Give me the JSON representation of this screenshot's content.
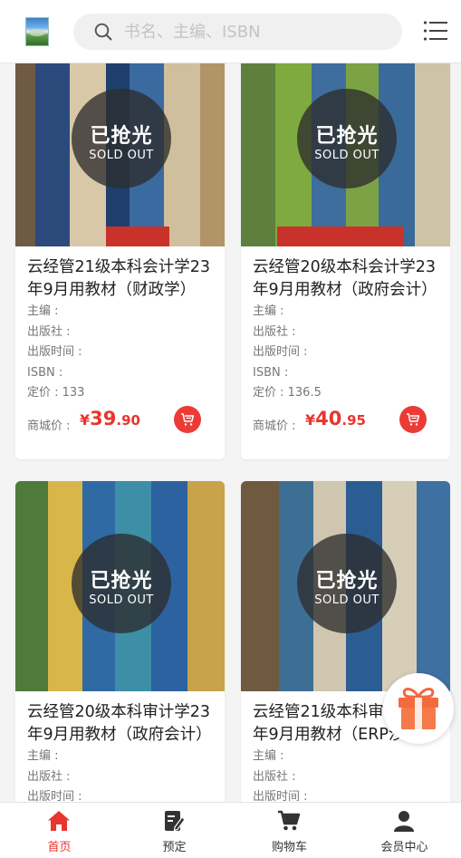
{
  "header": {
    "logo_alt": "logo",
    "search_placeholder": "书名、主编、ISBN"
  },
  "products": [
    {
      "title": "云经管21级本科会计学23年9月用教材（财政学）",
      "editor_label": "主编 :",
      "publisher_label": "出版社 :",
      "pubdate_label": "出版时间 :",
      "isbn_label": "ISBN :",
      "list_price": "定价 : 133",
      "price_label": "商城价 :",
      "price_symbol": "¥",
      "price_int": "39",
      "price_dec": ".90",
      "sold_out_cn": "已抢光",
      "sold_out_en": "SOLD OUT"
    },
    {
      "title": "云经管20级本科会计学23年9月用教材（政府会计）",
      "editor_label": "主编 :",
      "publisher_label": "出版社 :",
      "pubdate_label": "出版时间 :",
      "isbn_label": "ISBN :",
      "list_price": "定价 : 136.5",
      "price_label": "商城价 :",
      "price_symbol": "¥",
      "price_int": "40",
      "price_dec": ".95",
      "sold_out_cn": "已抢光",
      "sold_out_en": "SOLD OUT"
    },
    {
      "title": "云经管20级本科审计学23年9月用教材（政府会计）",
      "editor_label": "主编 :",
      "publisher_label": "出版社 :",
      "pubdate_label": "出版时间 :",
      "sold_out_cn": "已抢光",
      "sold_out_en": "SOLD OUT"
    },
    {
      "title": "云经管21级本科审计学23年9月用教材（ERP沙盘）",
      "editor_label": "主编 :",
      "publisher_label": "出版社 :",
      "pubdate_label": "出版时间 :",
      "sold_out_cn": "已抢光",
      "sold_out_en": "SOLD OUT"
    }
  ],
  "tabbar": {
    "items": [
      {
        "label": "首页",
        "icon": "home-icon",
        "active": true
      },
      {
        "label": "预定",
        "icon": "edit-icon"
      },
      {
        "label": "购物车",
        "icon": "cart-icon"
      },
      {
        "label": "会员中心",
        "icon": "user-icon"
      }
    ]
  },
  "colors": {
    "accent": "#e8352f",
    "sold_overlay": "#2d2d2d",
    "background": "#f4f4f4"
  }
}
